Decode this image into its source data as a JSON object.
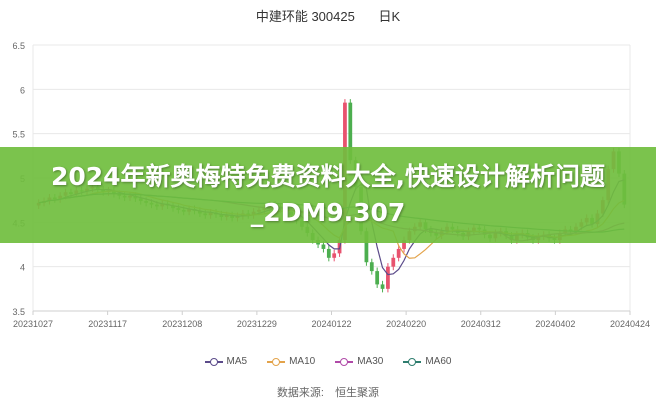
{
  "header": {
    "stock": "中建环能 300425",
    "period": "日K"
  },
  "overlay_text": "2024年新奥梅特免费资料大全,快速设计解析问题_2DM9.307",
  "source": {
    "label": "数据来源:",
    "name": "恒生聚源"
  },
  "colors": {
    "up": "#e8526e",
    "down": "#4cae4f",
    "ma5": "#5b4b8a",
    "ma10": "#e3a34a",
    "ma30": "#b04aa8",
    "ma60": "#2e7d6e",
    "grid": "#e8e8e8",
    "axis_text": "#666666"
  },
  "chart_data": {
    "type": "candlestick",
    "title": "中建环能 300425",
    "ylim": [
      3.5,
      6.5
    ],
    "yticks": [
      "3.5",
      "4",
      "4.5",
      "5",
      "5.5",
      "6",
      "6.5"
    ],
    "xticks": [
      "20231027",
      "20231117",
      "20231208",
      "20231229",
      "20240122",
      "20240220",
      "20240312",
      "20240402",
      "20240424"
    ],
    "grid": "horizontal",
    "legend_position": "bottom",
    "legend": [
      "MA5",
      "MA10",
      "MA30",
      "MA60"
    ],
    "close": [
      4.72,
      4.74,
      4.78,
      4.76,
      4.8,
      4.84,
      4.82,
      4.86,
      4.85,
      4.88,
      4.9,
      4.87,
      4.84,
      4.86,
      4.82,
      4.8,
      4.78,
      4.8,
      4.77,
      4.74,
      4.72,
      4.7,
      4.68,
      4.71,
      4.69,
      4.66,
      4.64,
      4.62,
      4.65,
      4.63,
      4.6,
      4.58,
      4.61,
      4.59,
      4.56,
      4.58,
      4.55,
      4.57,
      4.6,
      4.58,
      4.62,
      4.64,
      4.66,
      4.7,
      4.68,
      4.65,
      4.62,
      4.58,
      4.52,
      4.45,
      4.38,
      4.3,
      4.25,
      4.2,
      4.1,
      4.15,
      4.3,
      5.85,
      5.2,
      4.9,
      4.4,
      4.05,
      3.95,
      3.8,
      3.75,
      4.0,
      4.1,
      4.2,
      4.3,
      4.4,
      4.45,
      4.5,
      4.42,
      4.38,
      4.35,
      4.4,
      4.45,
      4.42,
      4.38,
      4.34,
      4.4,
      4.44,
      4.42,
      4.36,
      4.32,
      4.38,
      4.4,
      4.35,
      4.3,
      4.36,
      4.38,
      4.33,
      4.3,
      4.34,
      4.36,
      4.32,
      4.3,
      4.38,
      4.42,
      4.4,
      4.45,
      4.5,
      4.55,
      4.48,
      4.6,
      4.75,
      5.1,
      5.3,
      5.05,
      4.7
    ]
  }
}
